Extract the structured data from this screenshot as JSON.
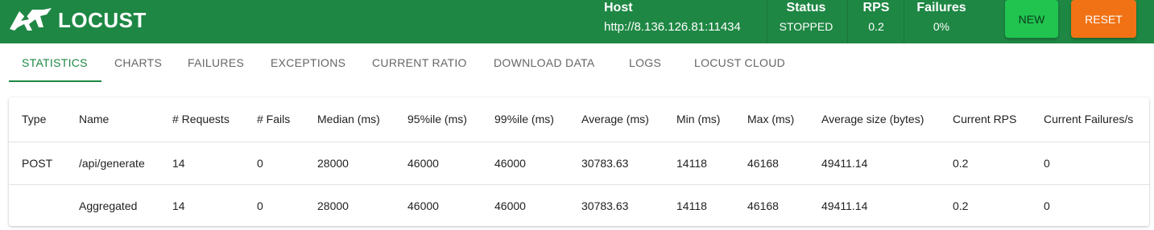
{
  "header": {
    "brand": "LOCUST",
    "host": {
      "label": "Host",
      "value": "http://8.136.126.81:11434"
    },
    "status": {
      "label": "Status",
      "value": "STOPPED"
    },
    "rps": {
      "label": "RPS",
      "value": "0.2"
    },
    "failures": {
      "label": "Failures",
      "value": "0%"
    },
    "new_label": "NEW",
    "reset_label": "RESET",
    "colors": {
      "bar": "#1e8744",
      "new": "#20c44f",
      "reset": "#f07214"
    }
  },
  "tabs": [
    {
      "label": "STATISTICS",
      "active": true
    },
    {
      "label": "CHARTS"
    },
    {
      "label": "FAILURES"
    },
    {
      "label": "EXCEPTIONS"
    },
    {
      "label": "CURRENT RATIO"
    },
    {
      "label": "DOWNLOAD DATA"
    },
    {
      "label": "LOGS"
    },
    {
      "label": "LOCUST CLOUD"
    }
  ],
  "table": {
    "columns": [
      "Type",
      "Name",
      "# Requests",
      "# Fails",
      "Median (ms)",
      "95%ile (ms)",
      "99%ile (ms)",
      "Average (ms)",
      "Min (ms)",
      "Max (ms)",
      "Average size (bytes)",
      "Current RPS",
      "Current Failures/s"
    ],
    "rows": [
      [
        "POST",
        "/api/generate",
        "14",
        "0",
        "28000",
        "46000",
        "46000",
        "30783.63",
        "14118",
        "46168",
        "49411.14",
        "0.2",
        "0"
      ],
      [
        "",
        "Aggregated",
        "14",
        "0",
        "28000",
        "46000",
        "46000",
        "30783.63",
        "14118",
        "46168",
        "49411.14",
        "0.2",
        "0"
      ]
    ]
  }
}
